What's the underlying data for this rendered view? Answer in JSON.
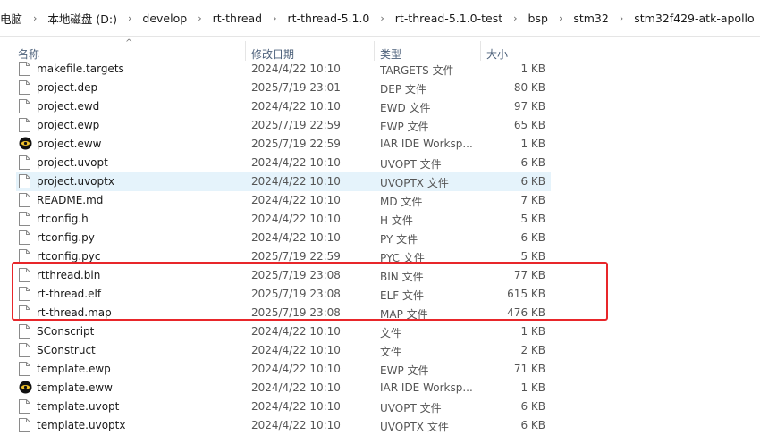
{
  "breadcrumb": [
    "电脑",
    "本地磁盘 (D:)",
    "develop",
    "rt-thread",
    "rt-thread-5.1.0",
    "rt-thread-5.1.0-test",
    "bsp",
    "stm32",
    "stm32f429-atk-apollo"
  ],
  "columns": {
    "name": "名称",
    "date": "修改日期",
    "type": "类型",
    "size": "大小"
  },
  "sort_icon": "^",
  "files": [
    {
      "name": "makefile.targets",
      "date": "2024/4/22 10:10",
      "type": "TARGETS 文件",
      "size": "1 KB",
      "icon": "file-icon"
    },
    {
      "name": "project.dep",
      "date": "2025/7/19 23:01",
      "type": "DEP 文件",
      "size": "80 KB",
      "icon": "file-icon"
    },
    {
      "name": "project.ewd",
      "date": "2024/4/22 10:10",
      "type": "EWD 文件",
      "size": "97 KB",
      "icon": "file-icon"
    },
    {
      "name": "project.ewp",
      "date": "2025/7/19 22:59",
      "type": "EWP 文件",
      "size": "65 KB",
      "icon": "file-icon"
    },
    {
      "name": "project.eww",
      "date": "2025/7/19 22:59",
      "type": "IAR IDE Worksp...",
      "size": "1 KB",
      "icon": "iar-icon"
    },
    {
      "name": "project.uvopt",
      "date": "2024/4/22 10:10",
      "type": "UVOPT 文件",
      "size": "6 KB",
      "icon": "file-icon"
    },
    {
      "name": "project.uvoptx",
      "date": "2024/4/22 10:10",
      "type": "UVOPTX 文件",
      "size": "6 KB",
      "icon": "file-icon",
      "selected": true
    },
    {
      "name": "README.md",
      "date": "2024/4/22 10:10",
      "type": "MD 文件",
      "size": "7 KB",
      "icon": "file-icon"
    },
    {
      "name": "rtconfig.h",
      "date": "2024/4/22 10:10",
      "type": "H 文件",
      "size": "5 KB",
      "icon": "file-icon"
    },
    {
      "name": "rtconfig.py",
      "date": "2024/4/22 10:10",
      "type": "PY 文件",
      "size": "6 KB",
      "icon": "file-icon"
    },
    {
      "name": "rtconfig.pyc",
      "date": "2025/7/19 22:59",
      "type": "PYC 文件",
      "size": "5 KB",
      "icon": "file-icon"
    },
    {
      "name": "rtthread.bin",
      "date": "2025/7/19 23:08",
      "type": "BIN 文件",
      "size": "77 KB",
      "icon": "file-icon"
    },
    {
      "name": "rt-thread.elf",
      "date": "2025/7/19 23:08",
      "type": "ELF 文件",
      "size": "615 KB",
      "icon": "file-icon"
    },
    {
      "name": "rt-thread.map",
      "date": "2025/7/19 23:08",
      "type": "MAP 文件",
      "size": "476 KB",
      "icon": "file-icon"
    },
    {
      "name": "SConscript",
      "date": "2024/4/22 10:10",
      "type": "文件",
      "size": "1 KB",
      "icon": "file-icon"
    },
    {
      "name": "SConstruct",
      "date": "2024/4/22 10:10",
      "type": "文件",
      "size": "2 KB",
      "icon": "file-icon"
    },
    {
      "name": "template.ewp",
      "date": "2024/4/22 10:10",
      "type": "EWP 文件",
      "size": "71 KB",
      "icon": "file-icon"
    },
    {
      "name": "template.eww",
      "date": "2024/4/22 10:10",
      "type": "IAR IDE Worksp...",
      "size": "1 KB",
      "icon": "iar-icon"
    },
    {
      "name": "template.uvopt",
      "date": "2024/4/22 10:10",
      "type": "UVOPT 文件",
      "size": "6 KB",
      "icon": "file-icon"
    },
    {
      "name": "template.uvoptx",
      "date": "2024/4/22 10:10",
      "type": "UVOPTX 文件",
      "size": "6 KB",
      "icon": "file-icon"
    }
  ],
  "colors": {
    "selected_row": "#e5f3fb",
    "highlight_box": "#e8262a",
    "header_text": "#4c607a"
  }
}
